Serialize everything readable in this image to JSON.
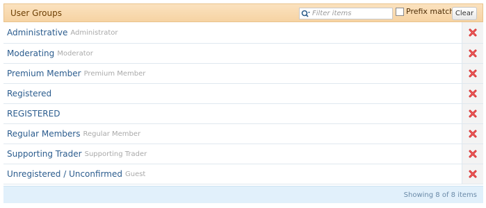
{
  "header": {
    "title": "User Groups",
    "filter_placeholder": "Filter items",
    "prefix_match_label": "Prefix match",
    "prefix_match_checked": false,
    "clear_label": "Clear"
  },
  "groups": [
    {
      "name": "Administrative",
      "title": "Administrator"
    },
    {
      "name": "Moderating",
      "title": "Moderator"
    },
    {
      "name": "Premium Member",
      "title": "Premium Member"
    },
    {
      "name": "Registered",
      "title": ""
    },
    {
      "name": "REGISTERED",
      "title": ""
    },
    {
      "name": "Regular Members",
      "title": "Regular Member"
    },
    {
      "name": "Supporting Trader",
      "title": "Supporting Trader"
    },
    {
      "name": "Unregistered / Unconfirmed",
      "title": "Guest"
    }
  ],
  "footer": {
    "status": "Showing 8 of 8 items"
  },
  "icons": {
    "search": "search-icon",
    "delete": "delete-icon"
  },
  "colors": {
    "header_bg": "#f6d3a3",
    "link": "#2b5c8e",
    "delete_red": "#d62b2b",
    "footer_bg": "#e1f0fb"
  }
}
